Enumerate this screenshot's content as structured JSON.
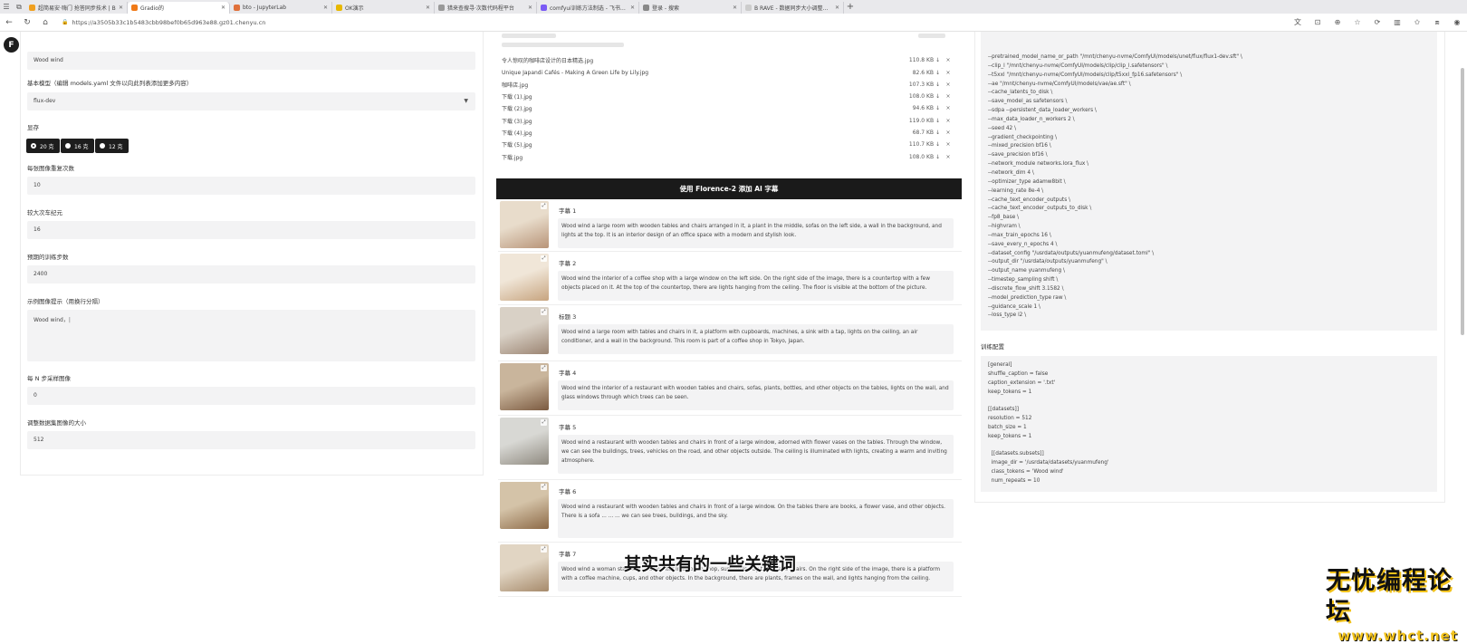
{
  "browser": {
    "tabs": [
      {
        "title": "超简易安·嗨门 抢答同步技术 | B",
        "color": "#f0a020",
        "active": false
      },
      {
        "title": "Gradio的",
        "color": "#f07a18",
        "active": true
      },
      {
        "title": "bto - JupyterLab",
        "color": "#e0703a",
        "active": false
      },
      {
        "title": "OK演示",
        "color": "#e8b800",
        "active": false
      },
      {
        "title": "猎来查搜寻·次数代码程平台",
        "color": "#999999",
        "active": false
      },
      {
        "title": "comfyui训练方法制选 - 飞书云文",
        "color": "#7a5af5",
        "active": false
      },
      {
        "title": "登录 - 搜索",
        "color": "#888888",
        "active": false
      },
      {
        "title": "B RAVE - 数据同步大小调整应用",
        "color": "#cccccc",
        "active": false
      }
    ],
    "url": "https://a3505b33c1b5483cbb98bef0b65d963e88.gz01.chenyu.cn"
  },
  "left": {
    "top_value": "Wood wind",
    "base_model_label": "基本模型（编辑 models.yaml 文件以向此列表添加更多内容）",
    "base_model_value": "flux-dev",
    "vram_label": "显存",
    "vram_options": [
      "20 克",
      "16 克",
      "12 克"
    ],
    "repeat_label": "每张图像重复次数",
    "repeat_value": "10",
    "epochs_label": "较大次车纪元",
    "epochs_value": "16",
    "steps_label": "预期的训练步数",
    "steps_value": "2400",
    "sample_label": "示例图像提示（用换行分隔）",
    "sample_value": "Wood wind，",
    "every_n_label": "每 N 步采样图像",
    "every_n_value": "0",
    "resize_label": "调整数据集图像的大小",
    "resize_value": "512"
  },
  "files": [
    {
      "name": "令人惊叹的咖啡店设计的日本精选.jpg",
      "size": "110.8 KB ↓"
    },
    {
      "name": "Unique Japandi Cafés - Making A Green Life by Lily.jpg",
      "size": "82.6 KB ↓"
    },
    {
      "name": "咖啡店.jpg",
      "size": "107.3 KB ↓"
    },
    {
      "name": "下载 (1).jpg",
      "size": "108.0 KB ↓"
    },
    {
      "name": "下载 (2).jpg",
      "size": "94.6 KB ↓"
    },
    {
      "name": "下载 (3).jpg",
      "size": "119.0 KB ↓"
    },
    {
      "name": "下载 (4).jpg",
      "size": "68.7 KB ↓"
    },
    {
      "name": "下载 (5).jpg",
      "size": "110.7 KB ↓"
    },
    {
      "name": "下载.jpg",
      "size": "108.0 KB ↓"
    }
  ],
  "florence_button": "使用 Florence-2 添加 AI 字幕",
  "captions": [
    {
      "label": "字幕 1",
      "text": "Wood wind a large room with wooden tables and chairs arranged in it, a plant in the middle, sofas on the left side, a wall in the background, and lights at the top. It is an interior design of an office space with a modern and stylish look."
    },
    {
      "label": "字幕 2",
      "text": "Wood wind the interior of a coffee shop with a large window on the left side. On the right side of the image, there is a countertop with a few objects placed on it. At the top of the countertop, there are lights hanging from the ceiling. The floor is visible at the bottom of the picture."
    },
    {
      "label": "标题 3",
      "text": "Wood wind a large room with tables and chairs in it, a platform with cupboards, machines, a sink with a tap, lights on the ceiling, an air conditioner, and a wall in the background. This room is part of a coffee shop in Tokyo, Japan."
    },
    {
      "label": "字幕 4",
      "text": "Wood wind the interior of a restaurant with wooden tables and chairs, sofas, plants, bottles, and other objects on the tables, lights on the wall, and glass windows through which trees can be seen."
    },
    {
      "label": "字幕 5",
      "text": "Wood wind a restaurant with wooden tables and chairs in front of a large window, adorned with flower vases on the tables. Through the window, we can see the buildings, trees, vehicles on the road, and other objects outside. The ceiling is illuminated with lights, creating a warm and inviting atmosphere."
    },
    {
      "label": "字幕 6",
      "text": "Wood wind a restaurant with wooden tables and chairs in front of a large window. On the tables there are books, a flower vase, and other objects. There is a sofa ... ... ... we can see trees, buildings, and the sky."
    },
    {
      "label": "字幕 7",
      "text": "Wood wind a woman standing at a counter in a coffee shop, surrounded by tables and chairs. On the right side of the image, there is a platform with a coffee machine, cups, and other objects. In the background, there are plants, frames on the wall, and lights hanging from the ceiling."
    }
  ],
  "command_lines": "--pretrained_model_name_or_path \"/mnt/chenyu-nvme/ComfyUI/models/unet/flux/flux1-dev.sft\" \\\n--clip_l \"/mnt/chenyu-nvme/ComfyUI/models/clip/clip_l.safetensors\" \\\n--t5xxl \"/mnt/chenyu-nvme/ComfyUI/models/clip/t5xxl_fp16.safetensors\" \\\n--ae \"/mnt/chenyu-nvme/ComfyUI/models/vae/ae.sft\" \\\n--cache_latents_to_disk \\\n--save_model_as safetensors \\\n--sdpa --persistent_data_loader_workers \\\n--max_data_loader_n_workers 2 \\\n--seed 42 \\\n--gradient_checkpointing \\\n--mixed_precision bf16 \\\n--save_precision bf16 \\\n--network_module networks.lora_flux \\\n--network_dim 4 \\\n--optimizer_type adamw8bit \\\n--learning_rate 8e-4 \\\n--cache_text_encoder_outputs \\\n--cache_text_encoder_outputs_to_disk \\\n--fp8_base \\\n--highvram \\\n--max_train_epochs 16 \\\n--save_every_n_epochs 4 \\\n--dataset_config \"/usrdata/outputs/yuanmufeng/dataset.toml\" \\\n--output_dir \"/usrdata/outputs/yuanmufeng\" \\\n--output_name yuanmufeng \\\n--timestep_sampling shift \\\n--discrete_flow_shift 3.1582 \\\n--model_prediction_type raw \\\n--guidance_scale 1 \\\n--loss_type l2 \\",
  "config_label": "训练配置",
  "config_text": "[general]\nshuffle_caption = false\ncaption_extension = '.txt'\nkeep_tokens = 1\n\n[[datasets]]\nresolution = 512\nbatch_size = 1\nkeep_tokens = 1\n\n  [[datasets.subsets]]\n  image_dir = '/usrdata/datasets/yuanmufeng'\n  class_tokens = 'Wood wind'\n  num_repeats = 10",
  "subtitle": "其实共有的一些关键词",
  "watermark": {
    "top": "无忧编程论坛",
    "bottom": "www.whct.net"
  }
}
